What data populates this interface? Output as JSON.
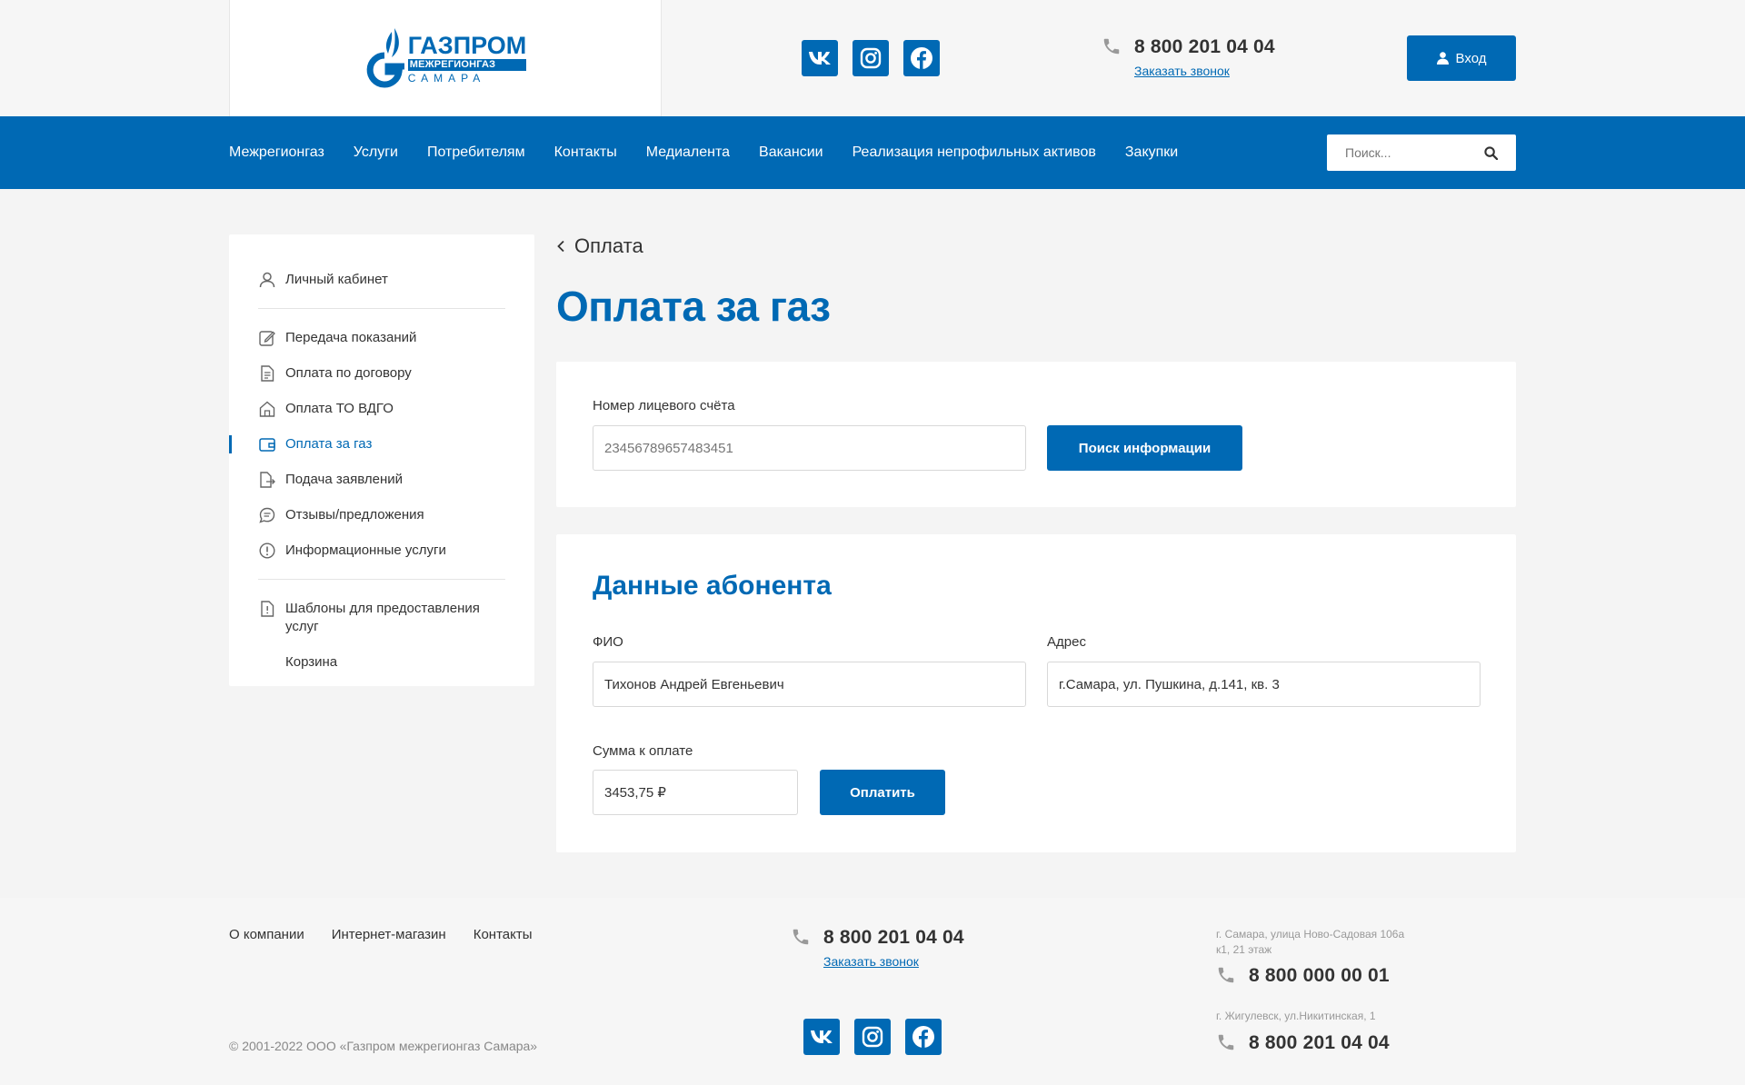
{
  "brand": {
    "line1": "ГАЗПРОМ",
    "line2": "МЕЖРЕГИОНГАЗ",
    "line3": "САМАРА",
    "accent_color": "#0069b4"
  },
  "header": {
    "socials": [
      {
        "name": "vk-icon",
        "glyph": "vk"
      },
      {
        "name": "instagram-icon",
        "glyph": "instagram"
      },
      {
        "name": "facebook-icon",
        "glyph": "facebook"
      }
    ],
    "phone": "8 800 201 04 04",
    "callback_link": "Заказать звонок",
    "login_label": "Вход"
  },
  "nav": {
    "items": [
      "Межрегионгаз",
      "Услуги",
      "Потребителям",
      "Контакты",
      "Медиалента",
      "Вакансии",
      "Реализация непрофильных активов",
      "Закупки"
    ],
    "search_placeholder": "Поиск..."
  },
  "sidebar": {
    "top_item": "Личный кабинет",
    "items": [
      {
        "label": "Передача показаний",
        "icon": "edit-icon"
      },
      {
        "label": "Оплата по договору",
        "icon": "document-icon"
      },
      {
        "label": "Оплата ТО ВДГО",
        "icon": "home-icon"
      },
      {
        "label": "Оплата за газ",
        "icon": "wallet-icon",
        "active": true
      },
      {
        "label": "Подача заявлений",
        "icon": "file-export-icon"
      },
      {
        "label": "Отзывы/предложения",
        "icon": "chat-icon"
      },
      {
        "label": "Информационные услуги",
        "icon": "info-icon"
      }
    ],
    "templates_item": "Шаблоны для предоставления услуг",
    "cart_item": "Корзина"
  },
  "main": {
    "breadcrumb": "Оплата",
    "title": "Оплата за газ",
    "account": {
      "label": "Номер лицевого счёта",
      "value": "23456789657483451",
      "search_button": "Поиск информации"
    },
    "subscriber": {
      "title": "Данные абонента",
      "fio_label": "ФИО",
      "fio_value": "Тихонов Андрей Евгеньевич",
      "address_label": "Адрес",
      "address_value": "г.Самара, ул. Пушкина, д.141, кв. 3",
      "sum_label": "Сумма к оплате",
      "sum_value": "3453,75 ₽",
      "pay_button": "Оплатить"
    }
  },
  "footer": {
    "links": [
      "О компании",
      "Интернет-магазин",
      "Контакты"
    ],
    "copyright": "© 2001-2022 ООО «Газпром межрегионгаз Самара»",
    "phone": "8 800 201 04 04",
    "callback_link": "Заказать звонок",
    "offices": [
      {
        "address": "г. Самара, улица Ново-Садовая 106а к1, 21 этаж",
        "phone": "8 800 000 00 01"
      },
      {
        "address": "г. Жигулевск, ул.Никитинская, 1",
        "phone": "8 800 201 04 04"
      }
    ]
  }
}
